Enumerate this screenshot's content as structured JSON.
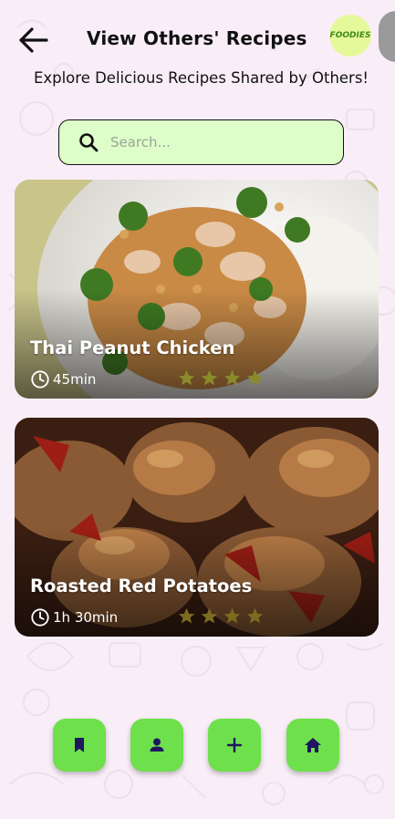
{
  "header": {
    "title": "View Others' Recipes",
    "logo_text": "FOODIES"
  },
  "subtitle": "Explore Delicious Recipes Shared by Others!",
  "search": {
    "placeholder": "Search...",
    "value": ""
  },
  "recipes": [
    {
      "title": "Thai Peanut Chicken",
      "time": "45min",
      "rating": 4
    },
    {
      "title": "Roasted Red Potatoes",
      "time": "1h 30min",
      "rating": 4
    }
  ],
  "bottom_nav": [
    {
      "icon": "bookmark-icon"
    },
    {
      "icon": "person-icon"
    },
    {
      "icon": "plus-icon"
    },
    {
      "icon": "home-icon"
    }
  ],
  "colors": {
    "background": "#f9eef7",
    "accent_green": "#6ee04c",
    "search_fill": "#ddfdc9",
    "nav_icon": "#1f1660",
    "star": "#8a8a2a"
  }
}
